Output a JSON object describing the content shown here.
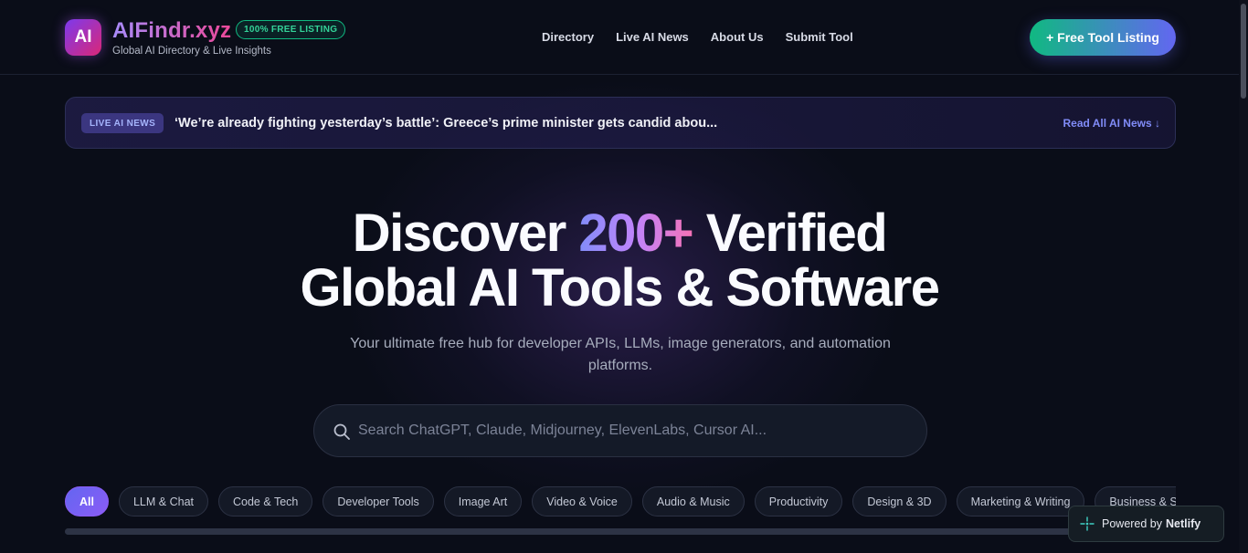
{
  "header": {
    "logo_text": "AI",
    "brand": "AIFindr.xyz",
    "badge": "100% FREE LISTING",
    "tagline": "Global AI Directory & Live Insights",
    "nav": [
      "Directory",
      "Live AI News",
      "About Us",
      "Submit Tool"
    ],
    "cta": "+ Free Tool Listing"
  },
  "news": {
    "badge": "LIVE AI NEWS",
    "headline": "‘We’re already fighting yesterday’s battle’: Greece’s prime minister gets candid abou...",
    "link": "Read All AI News ↓"
  },
  "hero": {
    "title_part1": "Discover ",
    "title_accent": "200+",
    "title_part2": " Verified",
    "title_line2": "Global AI Tools & Software",
    "subtitle": "Your ultimate free hub for developer APIs, LLMs, image generators, and automation platforms."
  },
  "search": {
    "placeholder": "Search ChatGPT, Claude, Midjourney, ElevenLabs, Cursor AI..."
  },
  "categories": [
    "All",
    "LLM & Chat",
    "Code & Tech",
    "Developer Tools",
    "Image Art",
    "Video & Voice",
    "Audio & Music",
    "Productivity",
    "Design & 3D",
    "Marketing & Writing",
    "Business & S"
  ],
  "netlify": {
    "prefix": "Powered by",
    "name": "Netlify"
  },
  "colors": {
    "background": "#0a0d18",
    "accent_purple": "#8b5cf6",
    "accent_green": "#10b981",
    "link": "#818cf8"
  }
}
